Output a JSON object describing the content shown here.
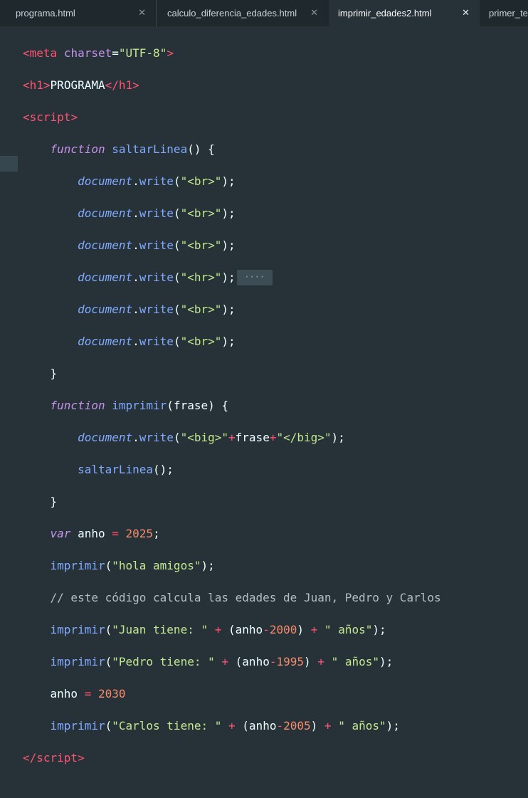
{
  "tabs": [
    {
      "label": "programa.html",
      "close": "✕",
      "active": false
    },
    {
      "label": "calculo_diferencia_edades.html",
      "close": "✕",
      "active": false
    },
    {
      "label": "imprimir_edades2.html",
      "close": "✕",
      "active": true
    },
    {
      "label": "primer_te",
      "close": "",
      "active": false
    }
  ],
  "code": {
    "l1": {
      "open": "<",
      "tag": "meta",
      "attr": "charset",
      "eq": "=",
      "val": "\"UTF-8\"",
      "close": ">"
    },
    "l2": {
      "open": "<",
      "tag": "h1",
      "close": ">",
      "text": "PROGRAMA",
      "endopen": "</",
      "endtag": "h1",
      "endclose": ">"
    },
    "l3": {
      "open": "<",
      "tag": "script",
      "close": ">"
    },
    "l4": {
      "kw": "function",
      "name": "saltarLinea",
      "rest": "() {"
    },
    "dw": {
      "obj": "document",
      "dot": ".",
      "fn": "write"
    },
    "l5": {
      "arg": "\"<br>\"",
      "end": ";"
    },
    "l6": {
      "arg": "\"<br>\"",
      "end": ";"
    },
    "l7": {
      "arg": "\"<br>\"",
      "end": ";"
    },
    "l8": {
      "arg": "\"<hr>\"",
      "end": ";",
      "fold": "····"
    },
    "l9": {
      "arg": "\"<br>\"",
      "end": ";"
    },
    "l10": {
      "arg": "\"<br>\"",
      "end": ";"
    },
    "l11": {
      "text": "}"
    },
    "l12": {
      "kw": "function",
      "name": "imprimir",
      "paren": "(",
      "param": "frase",
      "rest": ") {"
    },
    "l13": {
      "s1": "\"<big>\"",
      "plus": "+",
      "var": "frase",
      "s2": "\"</big>\"",
      "end": ");"
    },
    "l14": {
      "fn": "saltarLinea",
      "end": "();"
    },
    "l15": {
      "text": "}"
    },
    "l16": {
      "kw": "var",
      "name": "anho",
      "op": "=",
      "num": "2025",
      "end": ";"
    },
    "l17": {
      "fn": "imprimir",
      "str": "\"hola amigos\"",
      "end": ");"
    },
    "l18": {
      "comment": "// este código calcula las edades de Juan, Pedro y Carlos"
    },
    "l19": {
      "fn": "imprimir",
      "str": "\"Juan tiene: \"",
      "var": "anho",
      "num": "2000",
      "str2": "\" años\""
    },
    "l20": {
      "fn": "imprimir",
      "str": "\"Pedro tiene: \"",
      "var": "anho",
      "num": "1995",
      "str2": "\" años\""
    },
    "l21": {
      "name": "anho",
      "op": "=",
      "num": "2030"
    },
    "l22": {
      "fn": "imprimir",
      "str": "\"Carlos tiene: \"",
      "var": "anho",
      "num": "2005",
      "str2": "\" años\""
    },
    "l23": {
      "open": "</",
      "tag": "script",
      "close": ">"
    }
  }
}
